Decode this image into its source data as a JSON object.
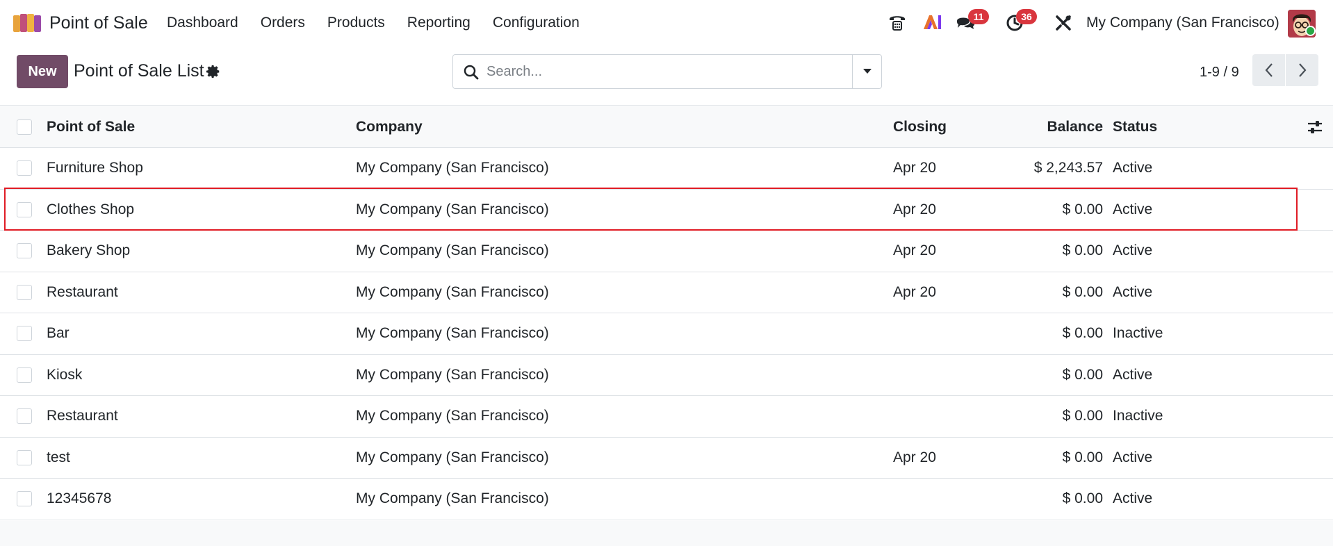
{
  "navbar": {
    "app_name": "Point of Sale",
    "menu": [
      "Dashboard",
      "Orders",
      "Products",
      "Reporting",
      "Configuration"
    ],
    "messages_count": "11",
    "activities_count": "36",
    "ai_label": "AI",
    "company": "My Company (San Francisco)"
  },
  "control_panel": {
    "new_label": "New",
    "title": "Point of Sale List",
    "search_placeholder": "Search...",
    "pager": "1-9 / 9"
  },
  "list": {
    "columns": [
      "Point of Sale",
      "Company",
      "Closing",
      "Balance",
      "Status"
    ],
    "rows": [
      {
        "name": "Furniture Shop",
        "company": "My Company (San Francisco)",
        "closing": "Apr 20",
        "balance": "$ 2,243.57",
        "status": "Active"
      },
      {
        "name": "Clothes Shop",
        "company": "My Company (San Francisco)",
        "closing": "Apr 20",
        "balance": "$ 0.00",
        "status": "Active"
      },
      {
        "name": "Bakery Shop",
        "company": "My Company (San Francisco)",
        "closing": "Apr 20",
        "balance": "$ 0.00",
        "status": "Active"
      },
      {
        "name": "Restaurant",
        "company": "My Company (San Francisco)",
        "closing": "Apr 20",
        "balance": "$ 0.00",
        "status": "Active"
      },
      {
        "name": "Bar",
        "company": "My Company (San Francisco)",
        "closing": "",
        "balance": "$ 0.00",
        "status": "Inactive"
      },
      {
        "name": "Kiosk",
        "company": "My Company (San Francisco)",
        "closing": "",
        "balance": "$ 0.00",
        "status": "Active"
      },
      {
        "name": "Restaurant",
        "company": "My Company (San Francisco)",
        "closing": "",
        "balance": "$ 0.00",
        "status": "Inactive"
      },
      {
        "name": "test",
        "company": "My Company (San Francisco)",
        "closing": "Apr 20",
        "balance": "$ 0.00",
        "status": "Active"
      },
      {
        "name": "12345678",
        "company": "My Company (San Francisco)",
        "closing": "",
        "balance": "$ 0.00",
        "status": "Active"
      }
    ]
  },
  "colors": {
    "brand": "#714b67",
    "badge": "#d9363e",
    "highlight": "#e01b24"
  }
}
